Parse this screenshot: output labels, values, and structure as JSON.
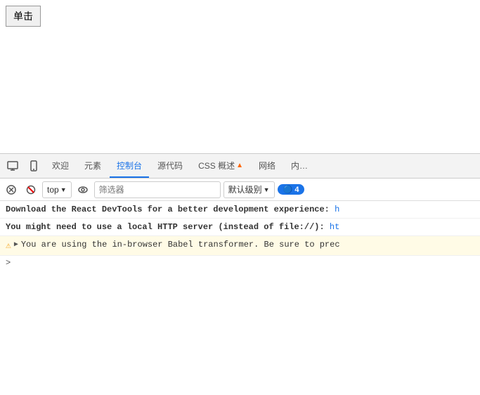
{
  "page": {
    "button_label": "单击",
    "background": "#ffffff"
  },
  "devtools": {
    "tabs": [
      {
        "id": "device-toggle",
        "icon": "📱",
        "type": "icon"
      },
      {
        "id": "responsive",
        "icon": "⊡",
        "type": "icon"
      },
      {
        "label": "欢迎",
        "active": false
      },
      {
        "label": "元素",
        "active": false
      },
      {
        "label": "控制台",
        "active": true
      },
      {
        "label": "源代码",
        "active": false
      },
      {
        "label": "CSS 概述",
        "active": false,
        "warning": true
      },
      {
        "label": "网络",
        "active": false
      },
      {
        "label": "内…",
        "active": false
      }
    ],
    "toolbar": {
      "clear_icon": "🚫",
      "filter_placeholder": "筛选器",
      "level_label": "top",
      "log_level_label": "默认级别",
      "message_count": "4",
      "eye_icon": "👁"
    },
    "console": {
      "messages": [
        {
          "type": "info",
          "text": "Download the React DevTools for a better development experience: h",
          "has_link": true
        },
        {
          "type": "info",
          "text": "You might need to use a local HTTP server (instead of file://): ht",
          "has_link": true
        },
        {
          "type": "warning",
          "text": "You are using the in-browser Babel transformer. Be sure to prec"
        },
        {
          "type": "caret",
          "text": ""
        }
      ]
    }
  }
}
